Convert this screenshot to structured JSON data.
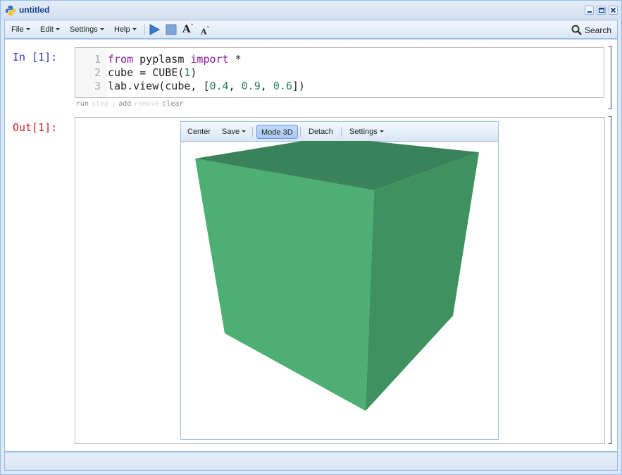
{
  "window": {
    "title": "untitled"
  },
  "menubar": {
    "file": "File",
    "edit": "Edit",
    "settings": "Settings",
    "help": "Help",
    "search": "Search"
  },
  "input_cell": {
    "prompt": "In [1]:",
    "line_numbers": [
      "1",
      "2",
      "3"
    ],
    "code": {
      "l1_kw1": "from",
      "l1_mod": " pyplasm ",
      "l1_kw2": "import",
      "l1_rest": " *",
      "l2_a": "cube = CUBE(",
      "l2_num": "1",
      "l2_b": ")",
      "l3_a": "lab.view(cube, [",
      "l3_n1": "0.4",
      "l3_c1": ", ",
      "l3_n2": "0.9",
      "l3_c2": ", ",
      "l3_n3": "0.6",
      "l3_b": "])"
    },
    "actions": {
      "run": "run",
      "stop": "stop",
      "sep": "|",
      "add": "add",
      "remove": "remove",
      "clear": "clear"
    }
  },
  "output_cell": {
    "prompt": "Out[1]:",
    "viewer": {
      "center": "Center",
      "save": "Save",
      "mode3d": "Mode 3D",
      "detach": "Detach",
      "settings": "Settings"
    },
    "cube_colors": {
      "top": "#3a8259",
      "front": "#4daf74",
      "side": "#3f915f"
    },
    "cube_color_rgb": [
      0.4,
      0.9,
      0.6
    ]
  }
}
